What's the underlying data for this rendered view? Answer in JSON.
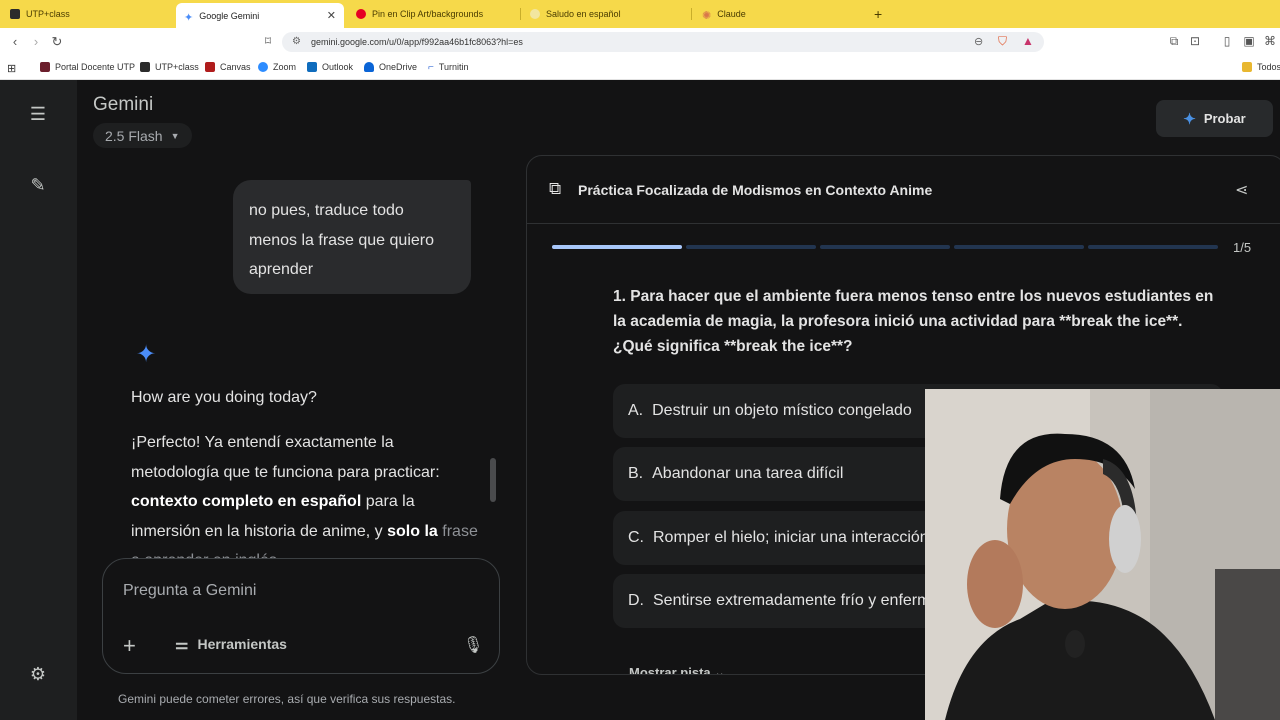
{
  "browser": {
    "tabs": [
      {
        "label": "UTP+class",
        "active": false
      },
      {
        "label": "Google Gemini",
        "active": true
      },
      {
        "label": "Pin en Clip Art/backgrounds",
        "active": false
      },
      {
        "label": "Saludo en español",
        "active": false
      },
      {
        "label": "Claude",
        "active": false
      }
    ],
    "new_tab": "+",
    "url": "gemini.google.com/u/0/app/f992aa46b1fc8063?hl=es",
    "bookmarks": [
      "Portal Docente UTP",
      "UTP+class",
      "Canvas",
      "Zoom",
      "Outlook",
      "OneDrive",
      "Turnitin"
    ],
    "bookmarks_folder": "Todos"
  },
  "app": {
    "brand": "Gemini",
    "model": "2.5 Flash",
    "try_label": "Probar"
  },
  "chat": {
    "user_message": "no pues, traduce todo menos la frase que quiero aprender",
    "reply_intro": "How are you doing today?",
    "reply_p1_a": "¡Perfecto! Ya entendí exactamente la metodología que te funciona para practicar: ",
    "reply_p1_bold": "contexto completo en español",
    "reply_p1_b": " para la inmersión en la historia de anime, y ",
    "reply_p1_bold2": "solo la",
    "reply_p1_fade": "frase a aprender en inglés"
  },
  "composer": {
    "placeholder": "Pregunta a Gemini",
    "tools_label": "Herramientas"
  },
  "disclaimer": "Gemini puede cometer errores, así que verifica sus respuestas.",
  "quiz": {
    "title": "Práctica Focalizada de Modismos en Contexto Anime",
    "progress": {
      "current": 1,
      "total": 5,
      "label": "1/5"
    },
    "question": "1. Para hacer que el ambiente fuera menos tenso entre los nuevos estudiantes en la academia de magia, la profesora inició una actividad para **break the ice**. ¿Qué significa **break the ice**?",
    "options": [
      {
        "letter": "A.",
        "text": "Destruir un objeto místico congelado"
      },
      {
        "letter": "B.",
        "text": "Abandonar una tarea difícil"
      },
      {
        "letter": "C.",
        "text": "Romper el hielo; iniciar una interacción"
      },
      {
        "letter": "D.",
        "text": "Sentirse extremadamente frío y enfermo"
      }
    ],
    "hint_label": "Mostrar pista"
  },
  "colors": {
    "accent_blue": "#4b8df8",
    "progress_active": "#a8c7fa",
    "background": "#131314",
    "tab_strip": "#f6d94a"
  }
}
